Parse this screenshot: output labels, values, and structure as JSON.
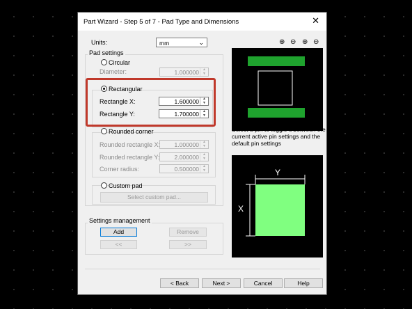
{
  "dialog": {
    "title": "Part Wizard - Step 5 of 7 - Pad Type and Dimensions",
    "close": "✕"
  },
  "units": {
    "label": "Units:",
    "value": "mm"
  },
  "pad_settings": {
    "legend": "Pad settings",
    "circular": {
      "label": "Circular",
      "diameter_label": "Diameter:",
      "diameter_value": "1.000000"
    },
    "rectangular": {
      "label": "Rectangular",
      "x_label": "Rectangle X:",
      "x_value": "1.600000",
      "y_label": "Rectangle Y:",
      "y_value": "1.700000"
    },
    "rounded": {
      "label": "Rounded corner",
      "x_label": "Rounded rectangle X:",
      "x_value": "1.000000",
      "y_label": "Rounded rectangle Y:",
      "y_value": "2.000000",
      "r_label": "Corner radius:",
      "r_value": "0.500000"
    },
    "custom": {
      "label": "Custom pad",
      "button": "Select custom pad..."
    }
  },
  "settings_management": {
    "legend": "Settings management",
    "add": "Add",
    "remove": "Remove",
    "prev": "<<",
    "next": ">>"
  },
  "preview": {
    "hint": "Select a pin to toggle it between the current active pin settings and the default pin settings",
    "dim_x": "X",
    "dim_y": "Y"
  },
  "zoom_icons": [
    "zoom-in-icon",
    "zoom-out-icon",
    "zoom-fit-icon",
    "zoom-actual-icon"
  ],
  "footer": {
    "back": "< Back",
    "next": "Next >",
    "cancel": "Cancel",
    "help": "Help"
  },
  "colors": {
    "highlight": "#c0392b",
    "pad_green": "#1fa32e",
    "preview_pad": "#80ff80"
  }
}
